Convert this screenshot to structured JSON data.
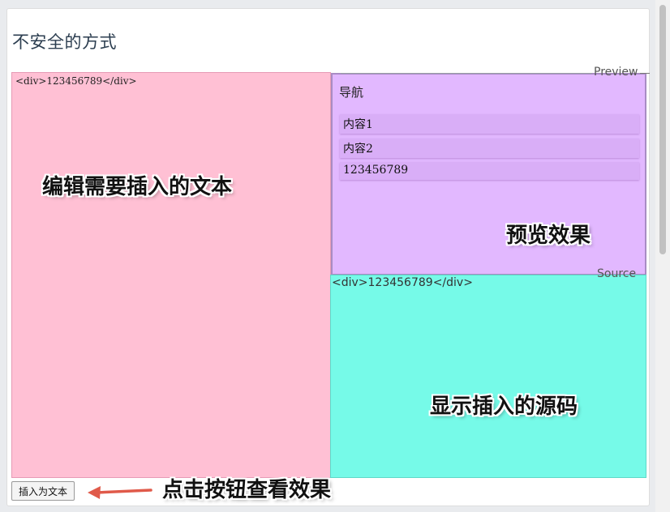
{
  "page": {
    "title": "不安全的方式"
  },
  "editor": {
    "value": "<div>123456789</div>"
  },
  "preview": {
    "label": "Preview",
    "nav_title": "导航",
    "items": [
      "内容1",
      "内容2",
      "123456789"
    ]
  },
  "source": {
    "label": "Source",
    "text": "<div>123456789</div>"
  },
  "annotations": {
    "editor": "编辑需要插入的文本",
    "preview": "预览效果",
    "source": "显示插入的源码",
    "button": "点击按钮查看效果"
  },
  "toolbar": {
    "insert_label": "插入为文本"
  },
  "colors": {
    "editor_bg": "#ffc0d4",
    "preview_bg": "#e2b8ff",
    "source_bg": "#76fae8",
    "arrow": "#e05a4a"
  }
}
